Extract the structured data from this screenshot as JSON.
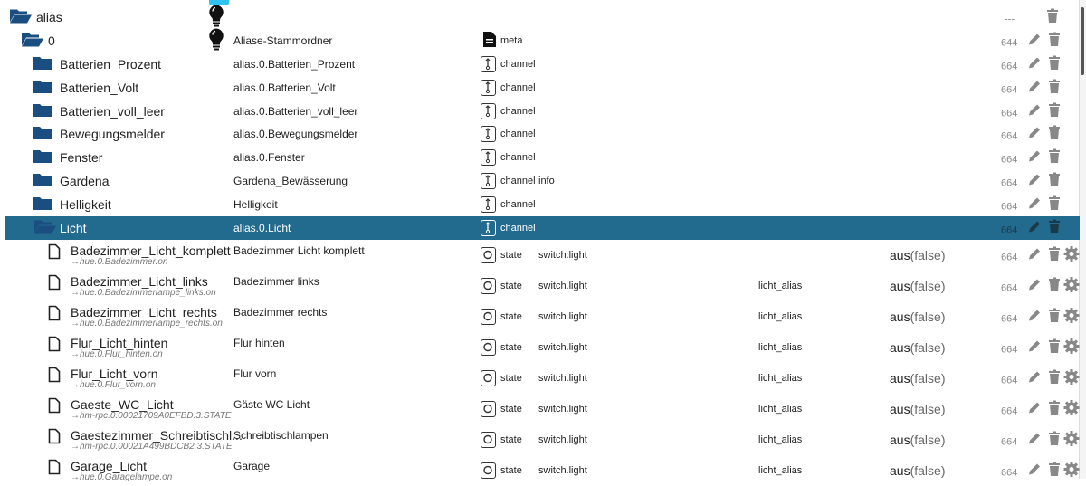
{
  "colors": {
    "selected": "#236b8e",
    "folder": "#1a4d80",
    "accent": "#2ec3f0"
  },
  "root": {
    "name": "alias",
    "rights": "---"
  },
  "instance": {
    "name": "0",
    "desc": "Aliase-Stammordner",
    "type": "meta",
    "rights": "644"
  },
  "channels": [
    {
      "name": "Batterien_Prozent",
      "desc": "alias.0.Batterien_Prozent",
      "type": "channel",
      "role": "",
      "rights": "664"
    },
    {
      "name": "Batterien_Volt",
      "desc": "alias.0.Batterien_Volt",
      "type": "channel",
      "role": "",
      "rights": "664"
    },
    {
      "name": "Batterien_voll_leer",
      "desc": "alias.0.Batterien_voll_leer",
      "type": "channel",
      "role": "",
      "rights": "664"
    },
    {
      "name": "Bewegungsmelder",
      "desc": "alias.0.Bewegungsmelder",
      "type": "channel",
      "role": "",
      "rights": "664"
    },
    {
      "name": "Fenster",
      "desc": "alias.0.Fenster",
      "type": "channel",
      "role": "",
      "rights": "664"
    },
    {
      "name": "Gardena",
      "desc": "Gardena_Bewässerung",
      "type": "channel",
      "role": "info",
      "rights": "664"
    },
    {
      "name": "Helligkeit",
      "desc": "Helligkeit",
      "type": "channel",
      "role": "",
      "rights": "664"
    },
    {
      "name": "Licht",
      "desc": "alias.0.Licht",
      "type": "channel",
      "role": "",
      "rights": "664"
    }
  ],
  "states": [
    {
      "name": "Badezimmer_Licht_komplett",
      "alias": "→hue.0.Badezimmer.on",
      "desc": "Badezimmer Licht komplett",
      "type": "state",
      "role": "switch.light",
      "room": "",
      "value": "aus",
      "raw": "(false)",
      "rights": "664"
    },
    {
      "name": "Badezimmer_Licht_links",
      "alias": "→hue.0.Badezimmerlampe_links.on",
      "desc": "Badezimmer links",
      "type": "state",
      "role": "switch.light",
      "room": "licht_alias",
      "value": "aus",
      "raw": "(false)",
      "rights": "664"
    },
    {
      "name": "Badezimmer_Licht_rechts",
      "alias": "→hue.0.Badezimmerlampe_rechts.on",
      "desc": "Badezimmer rechts",
      "type": "state",
      "role": "switch.light",
      "room": "licht_alias",
      "value": "aus",
      "raw": "(false)",
      "rights": "664"
    },
    {
      "name": "Flur_Licht_hinten",
      "alias": "→hue.0.Flur_hinten.on",
      "desc": "Flur hinten",
      "type": "state",
      "role": "switch.light",
      "room": "licht_alias",
      "value": "aus",
      "raw": "(false)",
      "rights": "664"
    },
    {
      "name": "Flur_Licht_vorn",
      "alias": "→hue.0.Flur_vorn.on",
      "desc": "Flur vorn",
      "type": "state",
      "role": "switch.light",
      "room": "licht_alias",
      "value": "aus",
      "raw": "(false)",
      "rights": "664"
    },
    {
      "name": "Gaeste_WC_Licht",
      "alias": "→hm-rpc.0.00021709A0EFBD.3.STATE",
      "desc": "Gäste WC Licht",
      "type": "state",
      "role": "switch.light",
      "room": "licht_alias",
      "value": "aus",
      "raw": "(false)",
      "rights": "664"
    },
    {
      "name": "Gaestezimmer_Schreibtischl...",
      "alias": "→hm-rpc.0.00021A499BDCB2.3.STATE",
      "desc": "Schreibtischlampen",
      "type": "state",
      "role": "switch.light",
      "room": "licht_alias",
      "value": "aus",
      "raw": "(false)",
      "rights": "664"
    },
    {
      "name": "Garage_Licht",
      "alias": "→hue.0.Garagelampe.on",
      "desc": "Garage",
      "type": "state",
      "role": "switch.light",
      "room": "licht_alias",
      "value": "aus",
      "raw": "(false)",
      "rights": "664"
    }
  ]
}
